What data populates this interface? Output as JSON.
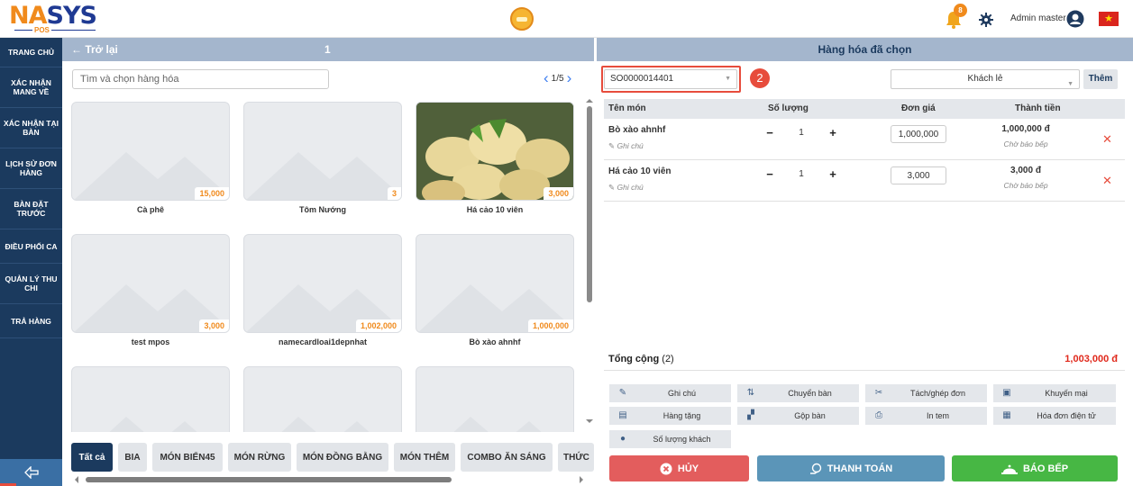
{
  "header": {
    "logo_text_na": "NA",
    "logo_text_sys": "SYS",
    "logo_sub": "POS",
    "notification_count": "8",
    "admin_name": "Admin master"
  },
  "sidebar": {
    "items": [
      "TRANG CHỦ",
      "XÁC NHẬN MANG VỀ",
      "XÁC NHẬN TẠI BÀN",
      "LỊCH SỬ ĐƠN HÀNG",
      "BÀN ĐẶT TRƯỚC",
      "ĐIỀU PHỐI CA",
      "QUẢN LÝ THU CHI",
      "TRẢ HÀNG"
    ]
  },
  "menu_panel": {
    "back_label": "← Trở lại",
    "table_number": "1",
    "search_placeholder": "Tìm và chọn hàng hóa",
    "pager": "1/5",
    "products": [
      {
        "name": "Cà phê",
        "price": "15,000"
      },
      {
        "name": "Tôm Nướng",
        "price": "3"
      },
      {
        "name": "Há cảo 10 viên",
        "price": "3,000"
      },
      {
        "name": "test mpos",
        "price": "3,000"
      },
      {
        "name": "namecardloai1depnhat",
        "price": "1,002,000"
      },
      {
        "name": "Bò xào ahnhf",
        "price": "1,000,000"
      },
      {
        "name": "",
        "price": ""
      },
      {
        "name": "",
        "price": ""
      },
      {
        "name": "",
        "price": ""
      }
    ],
    "categories": [
      "Tất cả",
      "BIA",
      "MÓN BIỂN45",
      "MÓN RỪNG",
      "MÓN ĐỒNG BẰNG",
      "MÓN THÊM",
      "COMBO ĂN SÁNG",
      "THỨC"
    ]
  },
  "order_panel": {
    "title": "Hàng hóa đã chọn",
    "order_code": "SO0000014401",
    "step_badge": "2",
    "customer": "Khách lẻ",
    "add_label": "Thêm",
    "columns": {
      "name": "Tên món",
      "qty": "Số lượng",
      "price": "Đơn giá",
      "total": "Thành tiền"
    },
    "items": [
      {
        "name": "Bò xào ahnhf",
        "note": "Ghi chú",
        "qty": "1",
        "price": "1,000,000",
        "total": "1,000,000 đ",
        "status": "Chờ báo bếp"
      },
      {
        "name": "Há cảo 10 viên",
        "note": "Ghi chú",
        "qty": "1",
        "price": "3,000",
        "total": "3,000 đ",
        "status": "Chờ báo bếp"
      }
    ],
    "total_label": "Tổng cộng",
    "total_count": "(2)",
    "total_value": "1,003,000 đ",
    "actions": [
      "Ghi chú",
      "Chuyển bàn",
      "Tách/ghép đơn",
      "Khuyến mại",
      "Hàng tặng",
      "Gộp bàn",
      "In tem",
      "Hóa đơn điện tử",
      "Số lượng khách"
    ],
    "cancel_label": "HỦY",
    "pay_label": "THANH TOÁN",
    "kitchen_label": "BÁO BẾP"
  },
  "colors": {
    "sidebar_bg": "#1b3a5e",
    "accent_orange": "#f08a1c",
    "cancel_red": "#e35d5d",
    "pay_blue": "#5b95b8",
    "kitchen_green": "#47b744"
  }
}
